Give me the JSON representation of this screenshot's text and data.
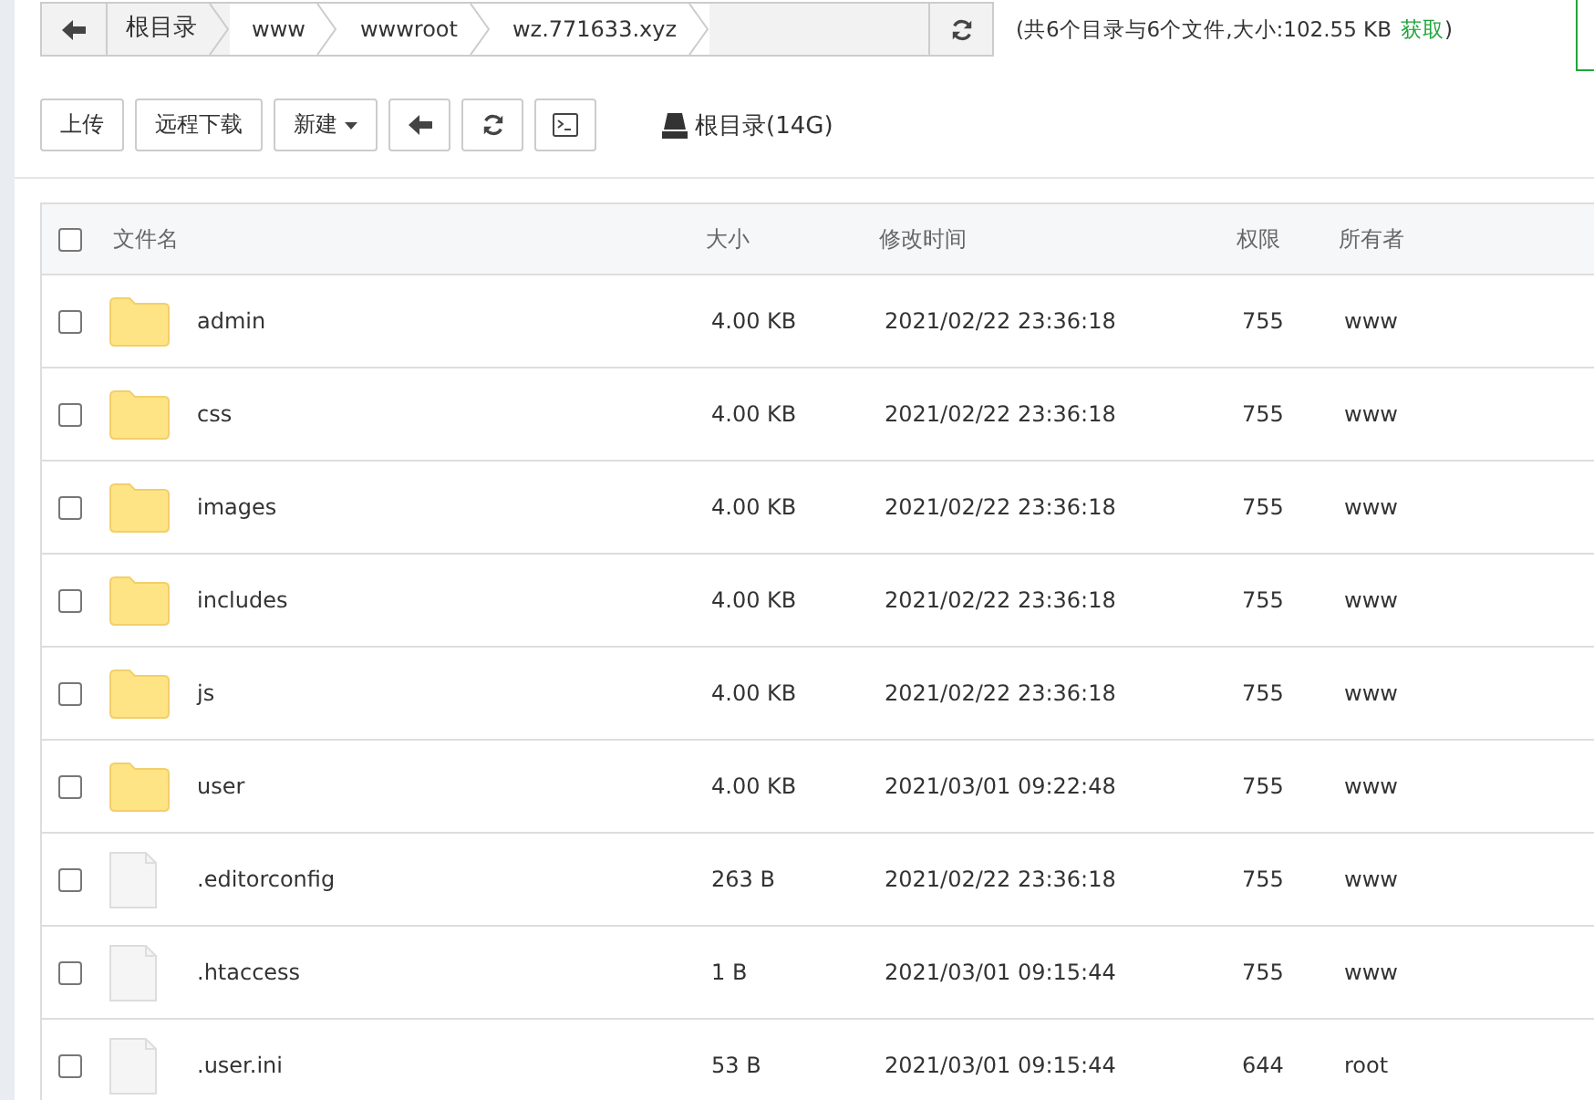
{
  "path_bar": {
    "crumbs": [
      "根目录",
      "www",
      "wwwroot",
      "wz.771633.xyz"
    ]
  },
  "summary": {
    "prefix": "(共6个目录与6个文件,大小:102.55 KB",
    "link": "获取",
    "suffix": ")"
  },
  "toolbar": [
    {
      "kind": "text",
      "label": "上传"
    },
    {
      "kind": "text",
      "label": "远程下载"
    },
    {
      "kind": "dropdown",
      "label": "新建"
    },
    {
      "kind": "back"
    },
    {
      "kind": "refresh"
    },
    {
      "kind": "terminal"
    }
  ],
  "disk": {
    "label": "根目录(14G)"
  },
  "table": {
    "all_checked": false,
    "columns": [
      "文件名",
      "大小",
      "修改时间",
      "权限",
      "所有者"
    ],
    "rows": [
      {
        "kind": "folder",
        "checked": false,
        "name": "admin",
        "size": "4.00 KB",
        "modified": "2021/02/22 23:36:18",
        "permission": "755",
        "owner": "www"
      },
      {
        "kind": "folder",
        "checked": false,
        "name": "css",
        "size": "4.00 KB",
        "modified": "2021/02/22 23:36:18",
        "permission": "755",
        "owner": "www"
      },
      {
        "kind": "folder",
        "checked": false,
        "name": "images",
        "size": "4.00 KB",
        "modified": "2021/02/22 23:36:18",
        "permission": "755",
        "owner": "www"
      },
      {
        "kind": "folder",
        "checked": false,
        "name": "includes",
        "size": "4.00 KB",
        "modified": "2021/02/22 23:36:18",
        "permission": "755",
        "owner": "www"
      },
      {
        "kind": "folder",
        "checked": false,
        "name": "js",
        "size": "4.00 KB",
        "modified": "2021/02/22 23:36:18",
        "permission": "755",
        "owner": "www"
      },
      {
        "kind": "folder",
        "checked": false,
        "name": "user",
        "size": "4.00 KB",
        "modified": "2021/03/01 09:22:48",
        "permission": "755",
        "owner": "www"
      },
      {
        "kind": "file",
        "checked": false,
        "name": ".editorconfig",
        "size": "263 B",
        "modified": "2021/02/22 23:36:18",
        "permission": "755",
        "owner": "www"
      },
      {
        "kind": "file",
        "checked": false,
        "name": ".htaccess",
        "size": "1 B",
        "modified": "2021/03/01 09:15:44",
        "permission": "755",
        "owner": "www"
      },
      {
        "kind": "file",
        "checked": false,
        "name": ".user.ini",
        "size": "53 B",
        "modified": "2021/03/01 09:15:44",
        "permission": "644",
        "owner": "root"
      }
    ]
  }
}
